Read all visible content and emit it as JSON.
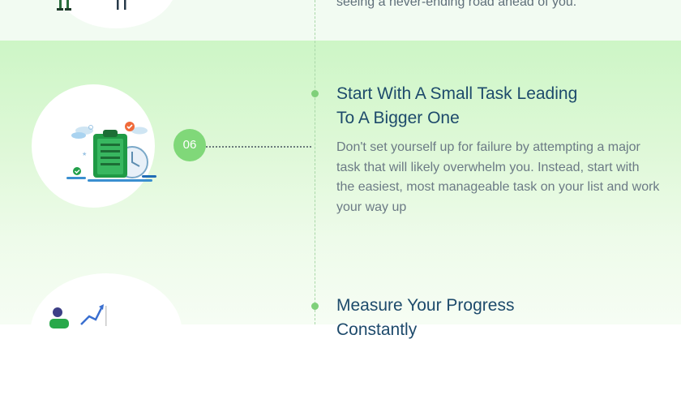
{
  "previous_step": {
    "description": "seeing a never-ending road ahead of you."
  },
  "current_step": {
    "number": "06",
    "title_line1": "Start With A Small Task Leading",
    "title_line2": "To A Bigger One",
    "description": "Don't set yourself up for failure by attempting a major task that will likely overwhelm you. Instead, start with the easiest, most manageable task on your list and work your way up",
    "illustration_icon": "clipboard-checklist-icon"
  },
  "next_step": {
    "title_line1": "Measure Your Progress",
    "title_line2": "Constantly",
    "illustration_icon": "person-growth-chart-icon"
  },
  "colors": {
    "accent_green": "#80d879",
    "title_navy": "#1d4a6b",
    "body_gray": "#6b7a85",
    "background_green": "#cdf6c6"
  }
}
